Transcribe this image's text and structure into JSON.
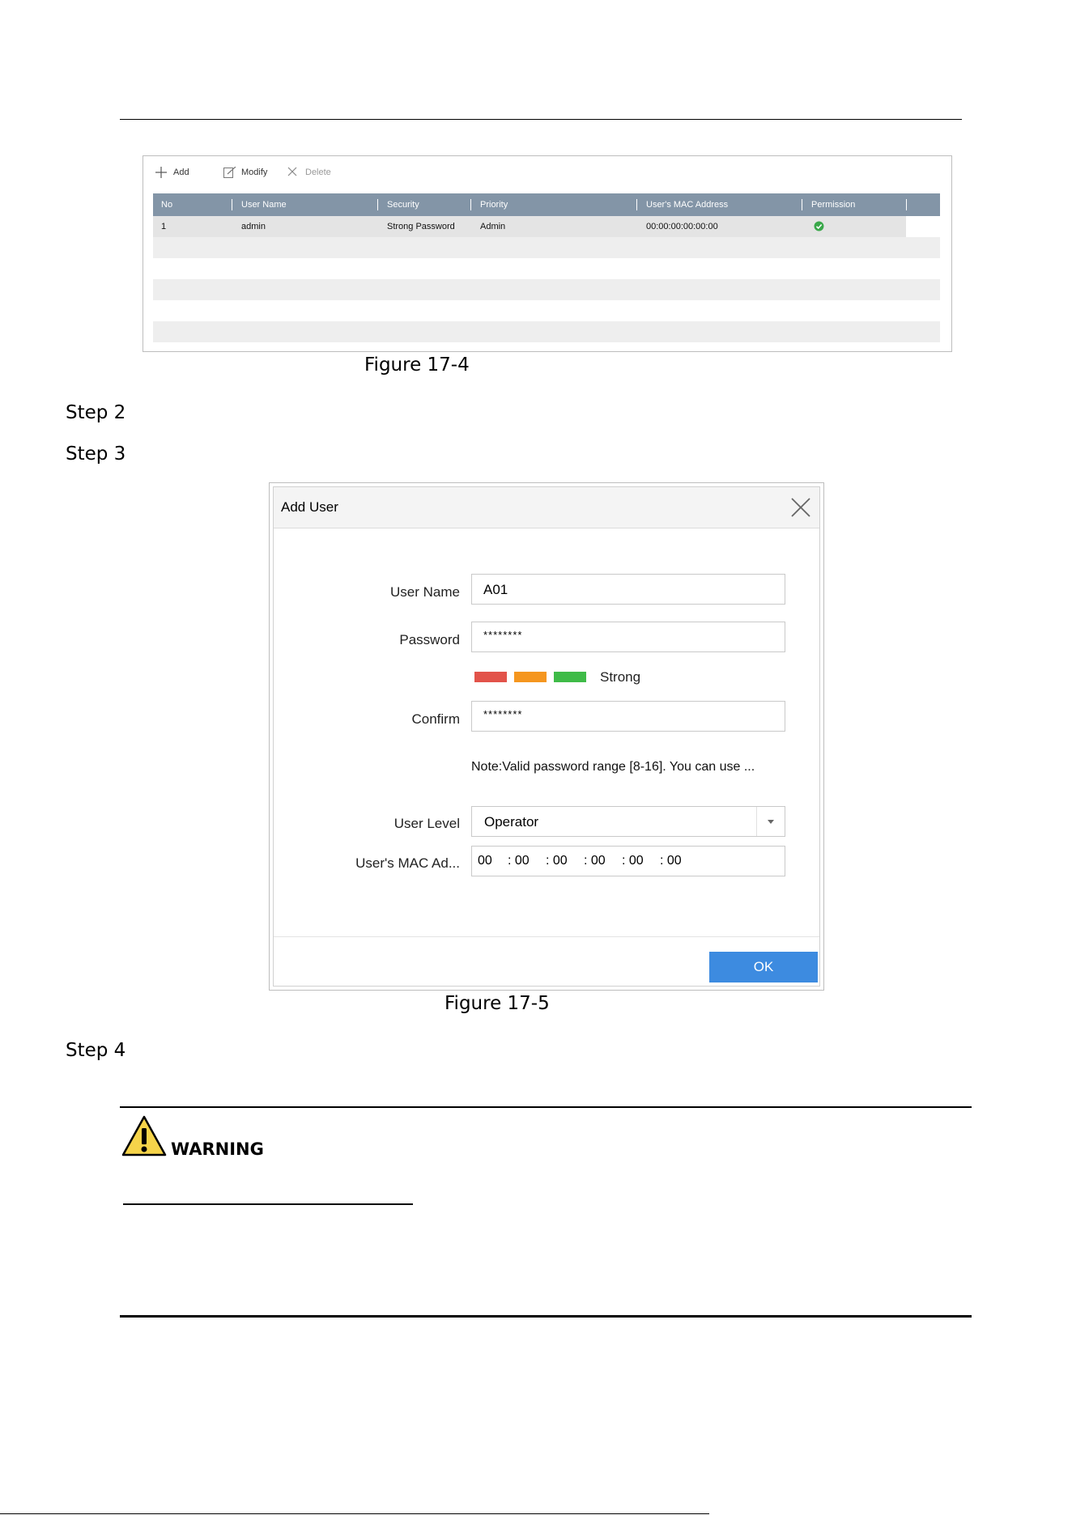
{
  "figure1": {
    "toolbar": {
      "add": "Add",
      "modify": "Modify",
      "delete": "Delete"
    },
    "columns": [
      "No",
      "User Name",
      "Security",
      "Priority",
      "User's MAC Address",
      "Permission"
    ],
    "rows": [
      {
        "no": "1",
        "user_name": "admin",
        "security": "Strong Password",
        "priority": "Admin",
        "mac": "00:00:00:00:00:00",
        "permission_icon": "check-circle-icon"
      }
    ],
    "caption": "Figure 17-4"
  },
  "steps": {
    "step2": "Step 2",
    "step3": "Step 3",
    "step4": "Step 4"
  },
  "dialog": {
    "title": "Add User",
    "user_name_label": "User Name",
    "user_name_value": "A01",
    "password_label": "Password",
    "password_value": "********",
    "strength_label": "Strong",
    "strength_colors": [
      "#e2534a",
      "#f5961f",
      "#3fbb48"
    ],
    "confirm_label": "Confirm",
    "confirm_value": "********",
    "note": "Note:Valid password range [8-16]. You can use ...",
    "user_level_label": "User Level",
    "user_level_value": "Operator",
    "mac_label": "User's MAC Ad...",
    "mac_segments": [
      "00",
      ": 00",
      ": 00",
      ": 00",
      ": 00",
      ": 00"
    ],
    "ok_label": "OK",
    "accent_color": "#3d8be0"
  },
  "figure2_caption": "Figure 17-5",
  "warning": {
    "label": "WARNING"
  }
}
